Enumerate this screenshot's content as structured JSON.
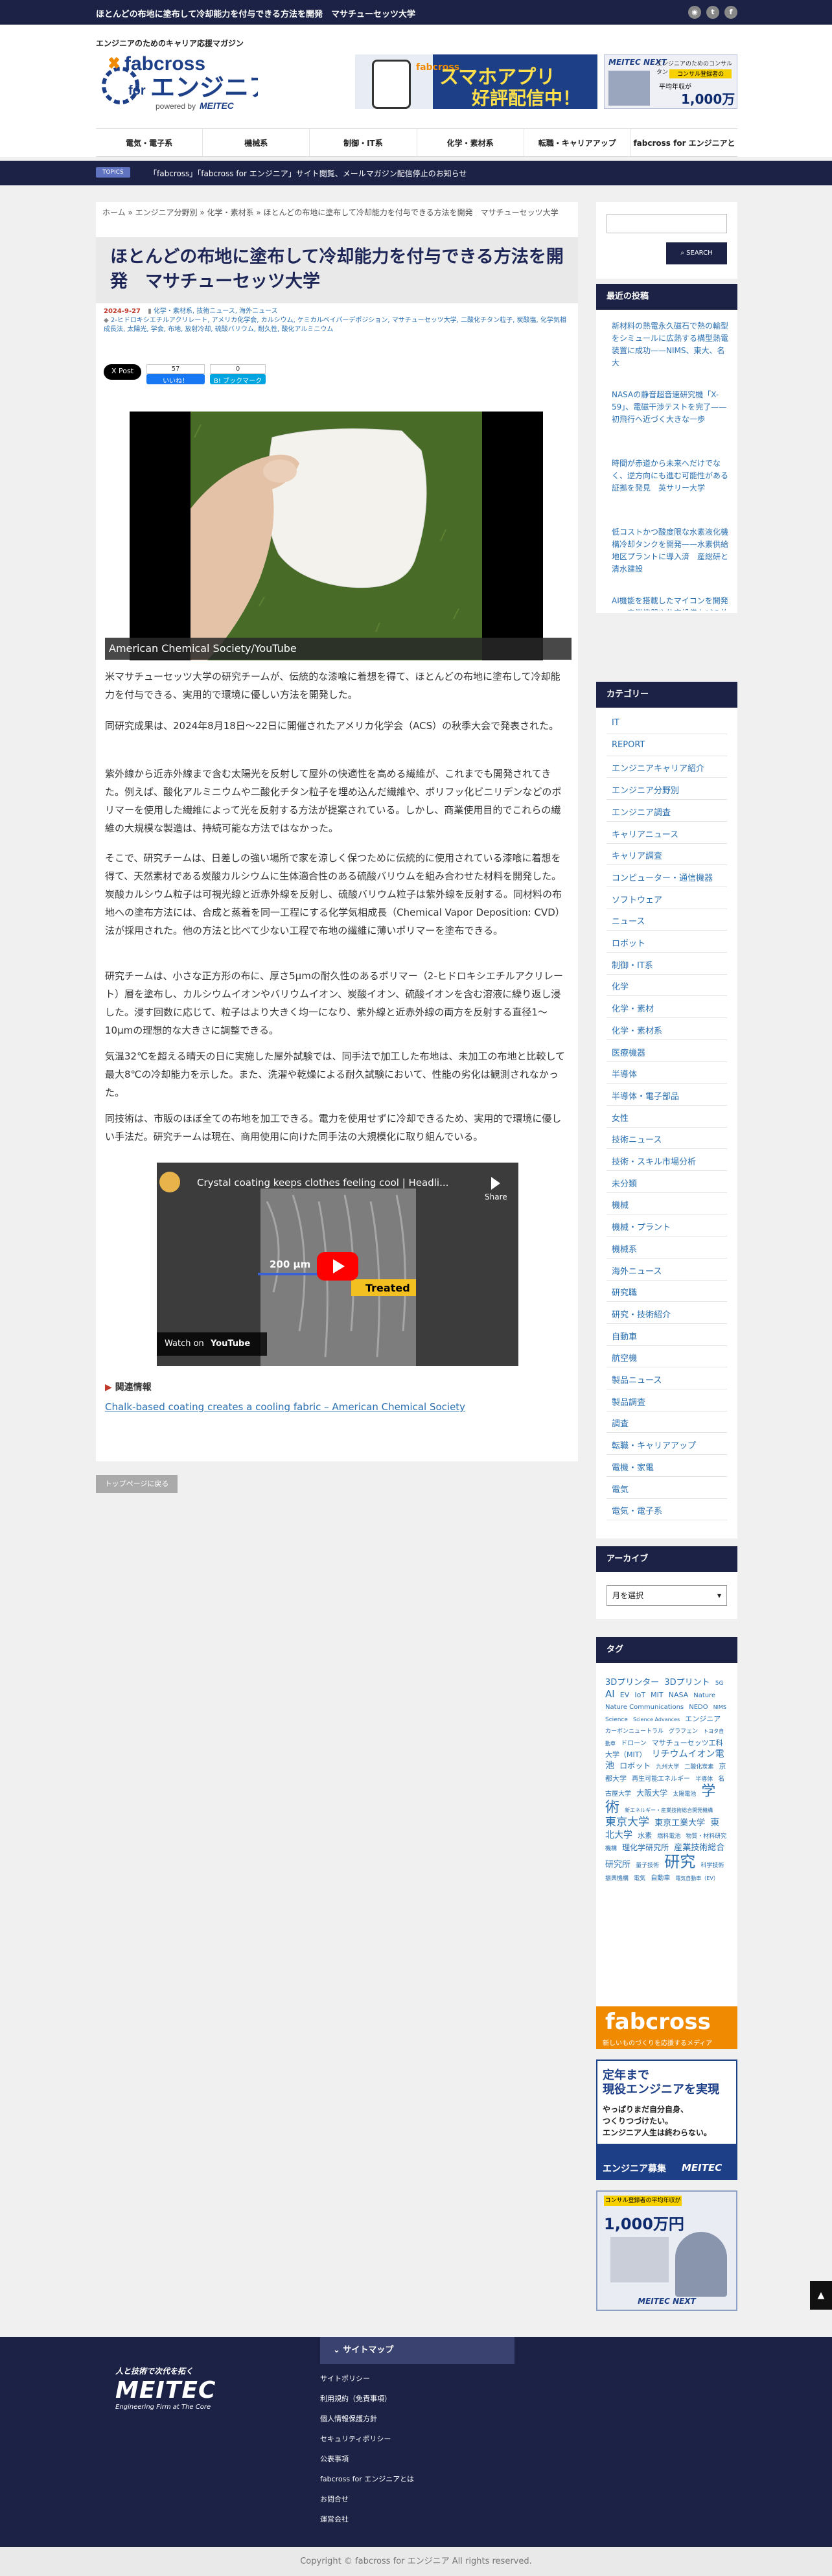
{
  "topbar": {
    "title": "ほとんどの布地に塗布して冷却能力を付与できる方法を開発　マサチューセッツ大学",
    "sns": [
      "rss-icon",
      "twitter-icon",
      "facebook-icon"
    ]
  },
  "header": {
    "tagline": "エンジニアのためのキャリア応援マガジン",
    "logo": {
      "brand": "fabcross",
      "for": "for",
      "name": "エンジニア",
      "powered": "powered by",
      "company": "MEITEC"
    },
    "ad1": {
      "brand": "fabcross",
      "headline1": "スマホアプリ",
      "headline2": "好評配信中！"
    },
    "ad2": {
      "brand": "MEITEC NEXT",
      "small": "エンジニアのためのコンサルタント",
      "line1": "コンサル登録者の",
      "line2": "平均年収が",
      "amount": "1,000万円"
    }
  },
  "nav": {
    "items": [
      "電気・電子系",
      "機械系",
      "制御・IT系",
      "化学・素材系",
      "転職・キャリアアップ",
      "fabcross for エンジニアとは"
    ]
  },
  "topics": {
    "badge": "TOPICS",
    "text": "「fabcross」「fabcross for エンジニア」サイト閲覧、メールマガジン配信停止のお知らせ"
  },
  "breadcrumb": {
    "text": "ホーム » エンジニア分野別 » 化学・素材系 » ほとんどの布地に塗布して冷却能力を付与できる方法を開発　マサチューセッツ大学"
  },
  "article": {
    "title": "ほとんどの布地に塗布して冷却能力を付与できる方法を開発　マサチューセッツ大学",
    "date": "2024-9-27",
    "categories": "化学・素材系, 技術ニュース, 海外ニュース",
    "tags": "2-ヒドロキシエチルアクリレート, アメリカ化学会, カルシウム, ケミカルベイパーデポジション, マサチューセッツ大学, 二酸化チタン粒子, 炭酸塩, 化学気相成長法, 太陽光, 学会, 布地, 放射冷却, 硫酸バリウム, 耐久性, 酸化アルミニウム",
    "share": {
      "post": "X Post",
      "like_count": "57",
      "like": "いいね！",
      "hatena_count": "0",
      "hatena": "B! ブックマーク"
    },
    "hero_caption": "American Chemical Society/YouTube",
    "paragraphs": [
      "米マサチューセッツ大学の研究チームが、伝統的な漆喰に着想を得て、ほとんどの布地に塗布して冷却能力を付与できる、実用的で環境に優しい方法を開発した。",
      "同研究成果は、2024年8月18日〜22日に開催されたアメリカ化学会（ACS）の秋季大会で発表された。",
      "紫外線から近赤外線まで含む太陽光を反射して屋外の快適性を高める繊維が、これまでも開発されてきた。例えば、酸化アルミニウムや二酸化チタン粒子を埋め込んだ繊維や、ポリフッ化ビニリデンなどのポリマーを使用した繊維によって光を反射する方法が提案されている。しかし、商業使用目的でこれらの繊維の大規模な製造は、持続可能な方法ではなかった。",
      "そこで、研究チームは、日差しの強い場所で家を涼しく保つために伝統的に使用されている漆喰に着想を得て、天然素材である炭酸カルシウムに生体適合性のある硫酸バリウムを組み合わせた材料を開発した。炭酸カルシウム粒子は可視光線と近赤外線を反射し、硫酸バリウム粒子は紫外線を反射する。同材料の布地への塗布方法には、合成と蒸着を同一工程にする化学気相成長（Chemical Vapor Deposition: CVD）法が採用された。他の方法と比べて少ない工程で布地の繊維に薄いポリマーを塗布できる。",
      "研究チームは、小さな正方形の布に、厚さ5μmの耐久性のあるポリマー（2-ヒドロキシエチルアクリレート）層を塗布し、カルシウムイオンやバリウムイオン、炭酸イオン、硫酸イオンを含む溶液に繰り返し浸した。浸す回数に応じて、粒子はより大きく均一になり、紫外線と近赤外線の両方を反射する直径1〜10μmの理想的な大きさに調整できる。",
      "気温32℃を超える晴天の日に実施した屋外試験では、同手法で加工した布地は、未加工の布地と比較して最大8℃の冷却能力を示した。また、洗濯や乾燥による耐久試験において、性能の劣化は観測されなかった。",
      "同技術は、市販のほぼ全ての布地を加工できる。電力を使用せずに冷却できるため、実用的で環境に優しい手法だ。研究チームは現在、商用使用に向けた同手法の大規模化に取り組んでいる。"
    ],
    "video": {
      "title": "Crystal coating keeps clothes feeling cool | Headli...",
      "share": "Share",
      "scale": "200 μm",
      "label": "Treated",
      "watch_on": "Watch on",
      "youtube": "YouTube"
    },
    "related_title": "関連情報",
    "related_link": "Chalk-based coating creates a cooling fabric – American Chemical Society",
    "back_to_top": "トップページに戻る"
  },
  "sidebar": {
    "search_button": "SEARCH",
    "recent_title": "最近の投稿",
    "recent": [
      "新材料の熱電永久磁石で熱の輸型をシミュールに広熱する構型熱電装置に成功——NIMS、東大、名大",
      "NASAの静音超音速研究機「X-59」、電磁干渉テストを完了——初飛行へ近づく大きな一歩",
      "時間が赤道から未来へだけでなく、逆方向にも進む可能性がある証拠を発見　英サリー大学",
      "低コストかつ酸度限な水素液化機構冷却タンクを開発——水素供給地区プラントに導入済　産総研と清水建設",
      "AI機能を搭載したマイコンを開発——産業機器や住宅設備などの故障予兆検知に最適　ローム"
    ],
    "category_title": "カテゴリー",
    "categories": [
      "IT",
      "REPORT",
      "エンジニアキャリア紹介",
      "エンジニア分野別",
      "エンジニア調査",
      "キャリアニュース",
      "キャリア調査",
      "コンピューター・通信機器",
      "ソフトウェア",
      "ニュース",
      "ロボット",
      "制御・IT系",
      "化学",
      "化学・素材",
      "化学・素材系",
      "医療機器",
      "半導体",
      "半導体・電子部品",
      "女性",
      "技術ニュース",
      "技術・スキル市場分析",
      "未分類",
      "機械",
      "機械・プラント",
      "機械系",
      "海外ニュース",
      "研究職",
      "研究・技術紹介",
      "自動車",
      "航空機",
      "製品ニュース",
      "製品調査",
      "調査",
      "転職・キャリアアップ",
      "電機・家電",
      "電気",
      "電気・電子系"
    ],
    "archive_title": "アーカイブ",
    "archive_select": "月を選択",
    "tag_title": "タグ",
    "tags": [
      {
        "t": "3Dプリンター",
        "s": 13
      },
      {
        "t": "3Dプリント",
        "s": 13
      },
      {
        "t": "5G",
        "s": 9
      },
      {
        "t": "AI",
        "s": 15
      },
      {
        "t": "EV",
        "s": 11
      },
      {
        "t": "IoT",
        "s": 11
      },
      {
        "t": "MIT",
        "s": 11
      },
      {
        "t": "NASA",
        "s": 11
      },
      {
        "t": "Nature",
        "s": 10
      },
      {
        "t": "Nature Communications",
        "s": 10
      },
      {
        "t": "NEDO",
        "s": 10
      },
      {
        "t": "NIMS",
        "s": 8
      },
      {
        "t": "Science",
        "s": 9
      },
      {
        "t": "Science Advances",
        "s": 8
      },
      {
        "t": "エンジニア",
        "s": 11
      },
      {
        "t": "カーボンニュートラル",
        "s": 9
      },
      {
        "t": "グラフェン",
        "s": 9
      },
      {
        "t": "トヨタ自動車",
        "s": 8
      },
      {
        "t": "ドローン",
        "s": 10
      },
      {
        "t": "マサチューセッツ工科大学（MIT）",
        "s": 11
      },
      {
        "t": "リチウムイオン電池",
        "s": 14
      },
      {
        "t": "ロボット",
        "s": 12
      },
      {
        "t": "九州大学",
        "s": 9
      },
      {
        "t": "二酸化炭素",
        "s": 9
      },
      {
        "t": "京都大学",
        "s": 11
      },
      {
        "t": "再生可能エネルギー",
        "s": 10
      },
      {
        "t": "半導体",
        "s": 9
      },
      {
        "t": "名古屋大学",
        "s": 10
      },
      {
        "t": "大阪大学",
        "s": 12
      },
      {
        "t": "太陽電池",
        "s": 9
      },
      {
        "t": "学術",
        "s": 22
      },
      {
        "t": "新エネルギー・産業技術総合開発機構",
        "s": 8
      },
      {
        "t": "東京大学",
        "s": 17
      },
      {
        "t": "東京工業大学",
        "s": 13
      },
      {
        "t": "東北大学",
        "s": 14
      },
      {
        "t": "水素",
        "s": 11
      },
      {
        "t": "燃料電池",
        "s": 9
      },
      {
        "t": "物質・材料研究機構",
        "s": 9
      },
      {
        "t": "理化学研究所",
        "s": 12
      },
      {
        "t": "産業技術総合研究所",
        "s": 13
      },
      {
        "t": "量子技術",
        "s": 9
      },
      {
        "t": "研究",
        "s": 24
      },
      {
        "t": "科学技術振興機構",
        "s": 9
      },
      {
        "t": "電気",
        "s": 9
      },
      {
        "t": "自動車",
        "s": 10
      },
      {
        "t": "電気自動車（EV）",
        "s": 8
      }
    ],
    "banner1": {
      "brand": "fabcross",
      "sub": "新しいものづくりを応援するメディア"
    },
    "banner2": {
      "line1": "定年まで",
      "line2": "現役エンジニアを実現",
      "line3": "やっぱりまだ自分自身、",
      "line4": "つくりつづけたい。",
      "line5": "エンジニア人生は終わらない。",
      "tag": "エンジニア募集",
      "brand": "MEITEC"
    },
    "banner3": {
      "small": "コンサル登録者の平均年収が",
      "amount": "1,000万円",
      "brand": "MEITEC NEXT"
    }
  },
  "page_top": "▲",
  "footer": {
    "slogan": "人と技術で次代を拓く",
    "company": "MEITEC",
    "company_sub": "Engineering Firm at The Core",
    "sitemap_title": "サイトマップ",
    "links": [
      "サイトポリシー",
      "利用規約（免責事項）",
      "個人情報保護方針",
      "セキュリティポリシー",
      "公表事項",
      "fabcross for エンジニアとは",
      "お問合せ",
      "運営会社"
    ],
    "copyright": "Copyright ©  fabcross for エンジニア All rights reserved."
  }
}
